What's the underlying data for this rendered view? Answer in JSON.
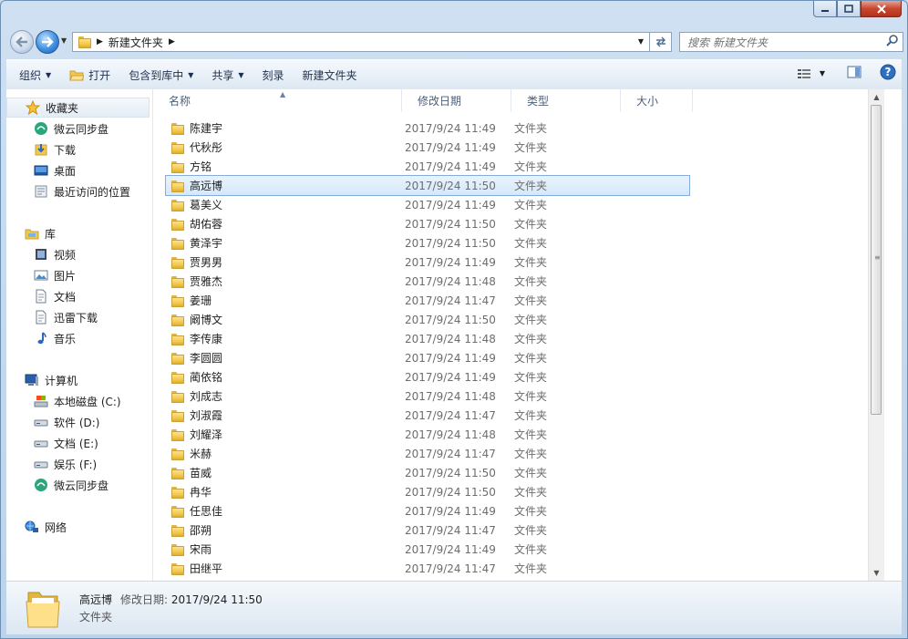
{
  "address": {
    "crumbs": [
      "新建文件夹"
    ],
    "search_placeholder": "搜索 新建文件夹"
  },
  "toolbar": {
    "organize": "组织",
    "open": "打开",
    "include_library": "包含到库中",
    "share": "共享",
    "burn": "刻录",
    "new_folder": "新建文件夹"
  },
  "sidebar": {
    "favorites": {
      "label": "收藏夹",
      "items": [
        "微云同步盘",
        "下载",
        "桌面",
        "最近访问的位置"
      ]
    },
    "libraries": {
      "label": "库",
      "items": [
        "视频",
        "图片",
        "文档",
        "迅雷下载",
        "音乐"
      ]
    },
    "computer": {
      "label": "计算机",
      "items": [
        "本地磁盘 (C:)",
        "软件 (D:)",
        "文档 (E:)",
        "娱乐 (F:)",
        "微云同步盘"
      ]
    },
    "network": {
      "label": "网络"
    }
  },
  "columns": {
    "name": "名称",
    "date": "修改日期",
    "type": "类型",
    "size": "大小"
  },
  "files": [
    {
      "name": "陈建宇",
      "date": "2017/9/24 11:49",
      "type": "文件夹"
    },
    {
      "name": "代秋彤",
      "date": "2017/9/24 11:49",
      "type": "文件夹"
    },
    {
      "name": "方铭",
      "date": "2017/9/24 11:49",
      "type": "文件夹"
    },
    {
      "name": "高远博",
      "date": "2017/9/24 11:50",
      "type": "文件夹",
      "selected": true
    },
    {
      "name": "葛美义",
      "date": "2017/9/24 11:49",
      "type": "文件夹"
    },
    {
      "name": "胡佑蓉",
      "date": "2017/9/24 11:50",
      "type": "文件夹"
    },
    {
      "name": "黄泽宇",
      "date": "2017/9/24 11:50",
      "type": "文件夹"
    },
    {
      "name": "贾男男",
      "date": "2017/9/24 11:49",
      "type": "文件夹"
    },
    {
      "name": "贾雅杰",
      "date": "2017/9/24 11:48",
      "type": "文件夹"
    },
    {
      "name": "姜珊",
      "date": "2017/9/24 11:47",
      "type": "文件夹"
    },
    {
      "name": "阚博文",
      "date": "2017/9/24 11:50",
      "type": "文件夹"
    },
    {
      "name": "李传康",
      "date": "2017/9/24 11:48",
      "type": "文件夹"
    },
    {
      "name": "李圆圆",
      "date": "2017/9/24 11:49",
      "type": "文件夹"
    },
    {
      "name": "蔺依铭",
      "date": "2017/9/24 11:49",
      "type": "文件夹"
    },
    {
      "name": "刘成志",
      "date": "2017/9/24 11:48",
      "type": "文件夹"
    },
    {
      "name": "刘淑霞",
      "date": "2017/9/24 11:47",
      "type": "文件夹"
    },
    {
      "name": "刘耀泽",
      "date": "2017/9/24 11:48",
      "type": "文件夹"
    },
    {
      "name": "米赫",
      "date": "2017/9/24 11:47",
      "type": "文件夹"
    },
    {
      "name": "苗威",
      "date": "2017/9/24 11:50",
      "type": "文件夹"
    },
    {
      "name": "冉华",
      "date": "2017/9/24 11:50",
      "type": "文件夹"
    },
    {
      "name": "任思佳",
      "date": "2017/9/24 11:49",
      "type": "文件夹"
    },
    {
      "name": "邵朔",
      "date": "2017/9/24 11:47",
      "type": "文件夹"
    },
    {
      "name": "宋雨",
      "date": "2017/9/24 11:49",
      "type": "文件夹"
    },
    {
      "name": "田继平",
      "date": "2017/9/24 11:47",
      "type": "文件夹"
    }
  ],
  "details": {
    "name": "高远博",
    "date_label": "修改日期:",
    "date_value": "2017/9/24 11:50",
    "type": "文件夹"
  },
  "colors": {
    "selection": "#d5e8fb",
    "selection_border": "#84acdd",
    "window_frame": "#bcd3ea"
  }
}
